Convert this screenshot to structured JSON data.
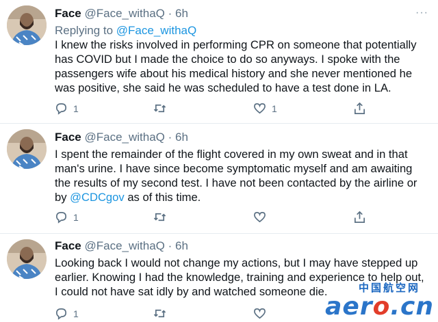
{
  "tweets": [
    {
      "name": "Face",
      "handle": "@Face_withaQ",
      "separator": "·",
      "time": "6h",
      "replying_prefix": "Replying to ",
      "replying_to": "@Face_withaQ",
      "text": "I knew the risks involved in performing CPR on someone that potentially has COVID but I made the choice to do so anyways. I spoke with the passengers wife about his medical history and she never mentioned he was positive, she said he was scheduled to have a test done in LA.",
      "reply_count": "1",
      "retweet_count": "",
      "like_count": "1"
    },
    {
      "name": "Face",
      "handle": "@Face_withaQ",
      "separator": "·",
      "time": "6h",
      "text_part1": "I spent the remainder of the flight covered in my own sweat and in that man's urine. I have since become symptomatic myself and am awaiting the results of my second test. I have not been contacted by the airline or by ",
      "mention": "@CDCgov",
      "text_part2": " as of this time.",
      "reply_count": "1",
      "retweet_count": "",
      "like_count": ""
    },
    {
      "name": "Face",
      "handle": "@Face_withaQ",
      "separator": "·",
      "time": "6h",
      "text": "Looking back I would not change my actions, but I may have stepped up earlier. Knowing I had the knowledge, training and experience to help out, I could not have sat idly by and watched someone die.",
      "reply_count": "1",
      "retweet_count": "",
      "like_count": ""
    }
  ],
  "more_label": "···",
  "icons": [
    "reply-icon",
    "retweet-icon",
    "like-icon",
    "share-icon",
    "more-icon"
  ],
  "colors": {
    "link": "#1b95e0",
    "muted": "#5b7083",
    "watermark_blue": "#2b75c9",
    "watermark_red": "#e23d2a"
  },
  "watermark": {
    "cn": "中国航空网",
    "en_a": "aer",
    "en_o": "o",
    "en_b": ".cn"
  }
}
